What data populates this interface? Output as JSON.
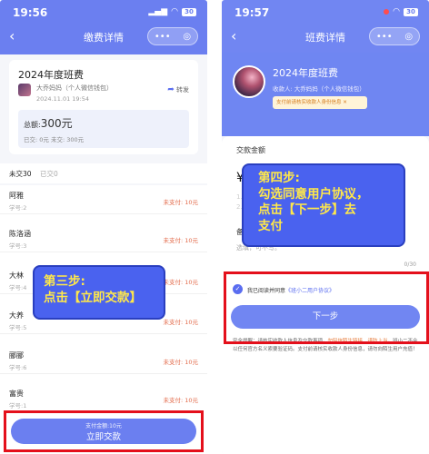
{
  "left": {
    "status": {
      "time": "19:56",
      "battery": "30"
    },
    "nav": {
      "back": "‹",
      "title": "缴费详情",
      "more": "•••",
      "target": "◎"
    },
    "card": {
      "year_title": "2024年度班费",
      "payee": "大乔妈妈（个人微信钱包）",
      "date": "2024.11.01 19:54",
      "share": "转发",
      "total_label": "总额:",
      "total_value": "300元",
      "paid_summary": "已交: 0元    未交: 300元"
    },
    "tabs": {
      "unpaid": "未交30",
      "paid": "已交0"
    },
    "students": [
      {
        "name": "阿雅",
        "no": "学号:2",
        "status": "未支付: 10元"
      },
      {
        "name": "陈洛涵",
        "no": "学号:3",
        "status": "未支付: 10元"
      },
      {
        "name": "大林",
        "no": "学号:4",
        "status": "未支付: 10元"
      },
      {
        "name": "大养",
        "no": "学号:5",
        "status": "未支付: 10元"
      },
      {
        "name": "郦郦",
        "no": "学号:6",
        "status": "未支付: 10元"
      },
      {
        "name": "富贵",
        "no": "学号:1",
        "status": "未支付: 10元"
      }
    ],
    "callout": {
      "line1": "第三步:",
      "line2": "点击【立即交款】"
    },
    "pay_button": {
      "sub": "支付金额:10元",
      "main": "立即交款"
    }
  },
  "right": {
    "status": {
      "time": "19:57",
      "battery": "30"
    },
    "nav": {
      "back": "‹",
      "title": "班费详情",
      "more": "•••",
      "target": "◎"
    },
    "card": {
      "year_title": "2024年度班费",
      "payee": "收款人: 大乔妈妈（个人微信钱包）",
      "warning": "支付前请核实收款人身份信息 ✕"
    },
    "form": {
      "amount_label": "交款金额",
      "yen": "¥",
      "hint1": "1.请",
      "hint2": "2.请",
      "memo_label": "备注",
      "memo_placeholder": "选填，可不写。",
      "counter": "0/30"
    },
    "callout": {
      "line1": "第四步:",
      "line2": "勾选同意用户协议，",
      "line3": "点击【下一步】去",
      "line4": "支付"
    },
    "agree": {
      "check": "✓",
      "text": "我已阅读并同意",
      "link": "《班小二用户协议》"
    },
    "next_button": "下一步",
    "notice": {
      "lead": "安全提醒：请核实收款人信息及交款事项，",
      "highlight": "勿轻信陌生链接、谨防上当",
      "tail": "，班小二不会以任何官方名义索要验证码。支付前请核实收款人身份信息，请勿向陌生用户充值！"
    }
  }
}
